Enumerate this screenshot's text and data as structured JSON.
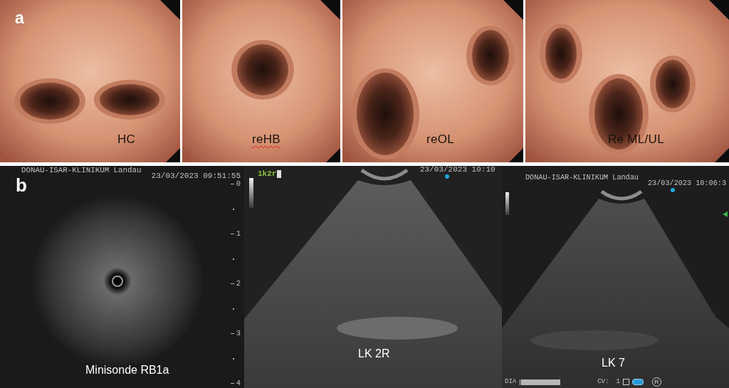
{
  "panel_a": {
    "label": "a",
    "photos": [
      {
        "caption": "HC",
        "misspelled": false
      },
      {
        "caption": "reHB",
        "misspelled": true
      },
      {
        "caption": "reOL",
        "misspelled": false
      },
      {
        "caption": "Re ML/UL",
        "misspelled": false
      }
    ]
  },
  "panel_b": {
    "label": "b",
    "scans": [
      {
        "kind": "radial",
        "header": "DONAU-ISAR-KLINIKUM Landau",
        "timestamp": "23/03/2023 09:51:55",
        "depth_scale": [
          "0",
          "1",
          "2",
          "3",
          "4"
        ],
        "caption": "Minisonde RB1a"
      },
      {
        "kind": "linear",
        "preset": "1k2r",
        "timestamp": "23/03/2023 10:10",
        "caption": "LK 2R"
      },
      {
        "kind": "linear",
        "header": "DONAU-ISAR-KLINIKUM Landau",
        "timestamp": "23/03/2023 10:06:3",
        "caption": "LK 7",
        "status_bar": {
          "mode": "DIA",
          "cv_label": "CV:",
          "cv_value": "1",
          "orientation": "R"
        }
      }
    ]
  }
}
